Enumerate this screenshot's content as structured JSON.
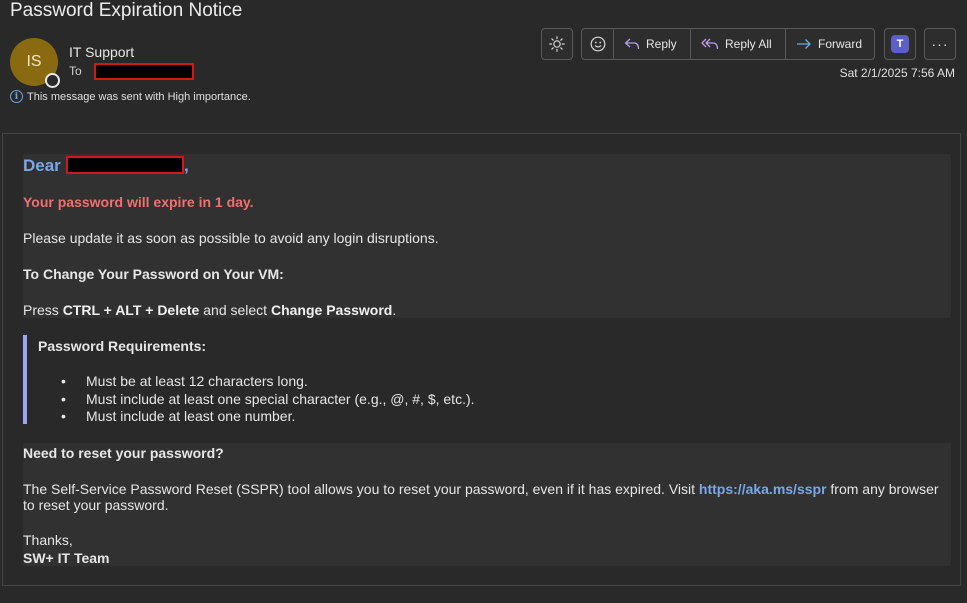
{
  "email": {
    "subject": "Password Expiration Notice",
    "sender_initials": "IS",
    "sender_name": "IT Support",
    "to_label": "To",
    "importance": "This message was sent with High importance.",
    "date": "Sat 2/1/2025 7:56 AM"
  },
  "toolbar": {
    "reply": "Reply",
    "reply_all": "Reply All",
    "forward": "Forward",
    "more": "···",
    "icons": [
      "brightness-icon",
      "emoji-icon",
      "reply-icon",
      "reply-all-icon",
      "forward-icon",
      "teams-icon",
      "more-icon"
    ]
  },
  "body": {
    "greeting": "Dear",
    "greeting_suffix": ",",
    "expiry_warning": "Your password will expire in 1 day.",
    "update_text": "Please update it as soon as possible to avoid any login disruptions.",
    "change_heading": "To Change Your Password on Your VM:",
    "press_prefix": "Press ",
    "keys": "CTRL + ALT + Delete",
    "press_middle": " and select ",
    "change_action": "Change Password",
    "press_suffix": ".",
    "requirements_heading": "Password Requirements:",
    "requirements": [
      "Must be at least 12 characters long.",
      "Must include at least one special character (e.g., @, #, $, etc.).",
      "Must include at least one number."
    ],
    "reset_heading": "Need to reset your password?",
    "sspr_prefix": "The Self-Service Password Reset (SSPR) tool allows you to reset your password, even if it has expired. Visit ",
    "sspr_link": "https://aka.ms/sspr",
    "sspr_suffix": " from any browser to reset your password.",
    "thanks": "Thanks,",
    "signature": "SW+ IT Team"
  },
  "colors": {
    "background": "#292929",
    "accent_link": "#7aa6ea",
    "warning": "#f07070",
    "avatar": "#8a6a10",
    "redaction_border": "#d01818"
  }
}
